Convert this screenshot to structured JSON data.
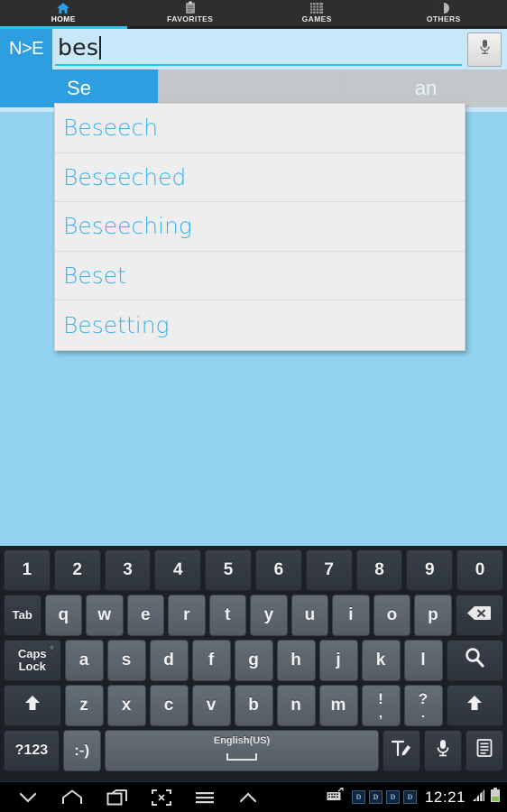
{
  "tabs": [
    {
      "label": "HOME",
      "icon": "home-icon",
      "active": true
    },
    {
      "label": "FAVORITES",
      "icon": "clipboard-icon",
      "active": false
    },
    {
      "label": "GAMES",
      "icon": "abacus-icon",
      "active": false
    },
    {
      "label": "OTHERS",
      "icon": "half-circle-icon",
      "active": false
    }
  ],
  "search": {
    "direction_label": "N>E",
    "value": "bes",
    "mic_icon": "microphone-icon"
  },
  "actions": {
    "search_label": "Se",
    "scan_label": "an"
  },
  "suggestions": [
    {
      "word": "Beseech"
    },
    {
      "word": "Beseeched"
    },
    {
      "word": "Beseeching"
    },
    {
      "word": "Beset"
    },
    {
      "word": "Besetting"
    }
  ],
  "keyboard": {
    "row1": [
      "1",
      "2",
      "3",
      "4",
      "5",
      "6",
      "7",
      "8",
      "9",
      "0"
    ],
    "row2_tab": "Tab",
    "row2": [
      "q",
      "w",
      "e",
      "r",
      "t",
      "y",
      "u",
      "i",
      "o",
      "p"
    ],
    "row2_backspace": "backspace-icon",
    "row3_caps": "Caps\nLock",
    "row3_caps_line1": "Caps",
    "row3_caps_line2": "Lock",
    "row3": [
      "a",
      "s",
      "d",
      "f",
      "g",
      "h",
      "j",
      "k",
      "l"
    ],
    "row3_search": "search-icon",
    "row4_shift_left": "shift-up-icon",
    "row4": [
      "z",
      "x",
      "c",
      "v",
      "b",
      "n",
      "m"
    ],
    "row4_punct1_top": "!",
    "row4_punct1_bottom": ",",
    "row4_punct2_top": "?",
    "row4_punct2_bottom": ".",
    "row4_shift_right": "shift-up-icon",
    "row5_symbols": "?123",
    "row5_emoji": ":-)",
    "row5_space_label": "English(US)",
    "row5_handwriting": "handwriting-icon",
    "row5_mic": "microphone-icon",
    "row5_clipboard": "clipboard-icon"
  },
  "navbar": {
    "icons": [
      "chevron-down-icon",
      "home-icon",
      "recents-icon",
      "screenshot-icon",
      "menu-icon",
      "chevron-up-icon"
    ],
    "status": {
      "keyboard_icon": "keyboard-indicator-icon",
      "app_badges": [
        "D",
        "D",
        "D",
        "D"
      ],
      "time": "12:21",
      "signal_icon": "signal-bars-icon",
      "battery_icon": "battery-icon"
    }
  },
  "colors": {
    "accent_blue": "#2d9ee0",
    "suggestion_text": "#37b3ef",
    "page_background": "#90d2f0",
    "search_background": "#c8e8fa",
    "tabbar_background": "#2e2e2e",
    "tab_underline": "#2ec0f0",
    "keyboard_background": "#1c1f23"
  }
}
